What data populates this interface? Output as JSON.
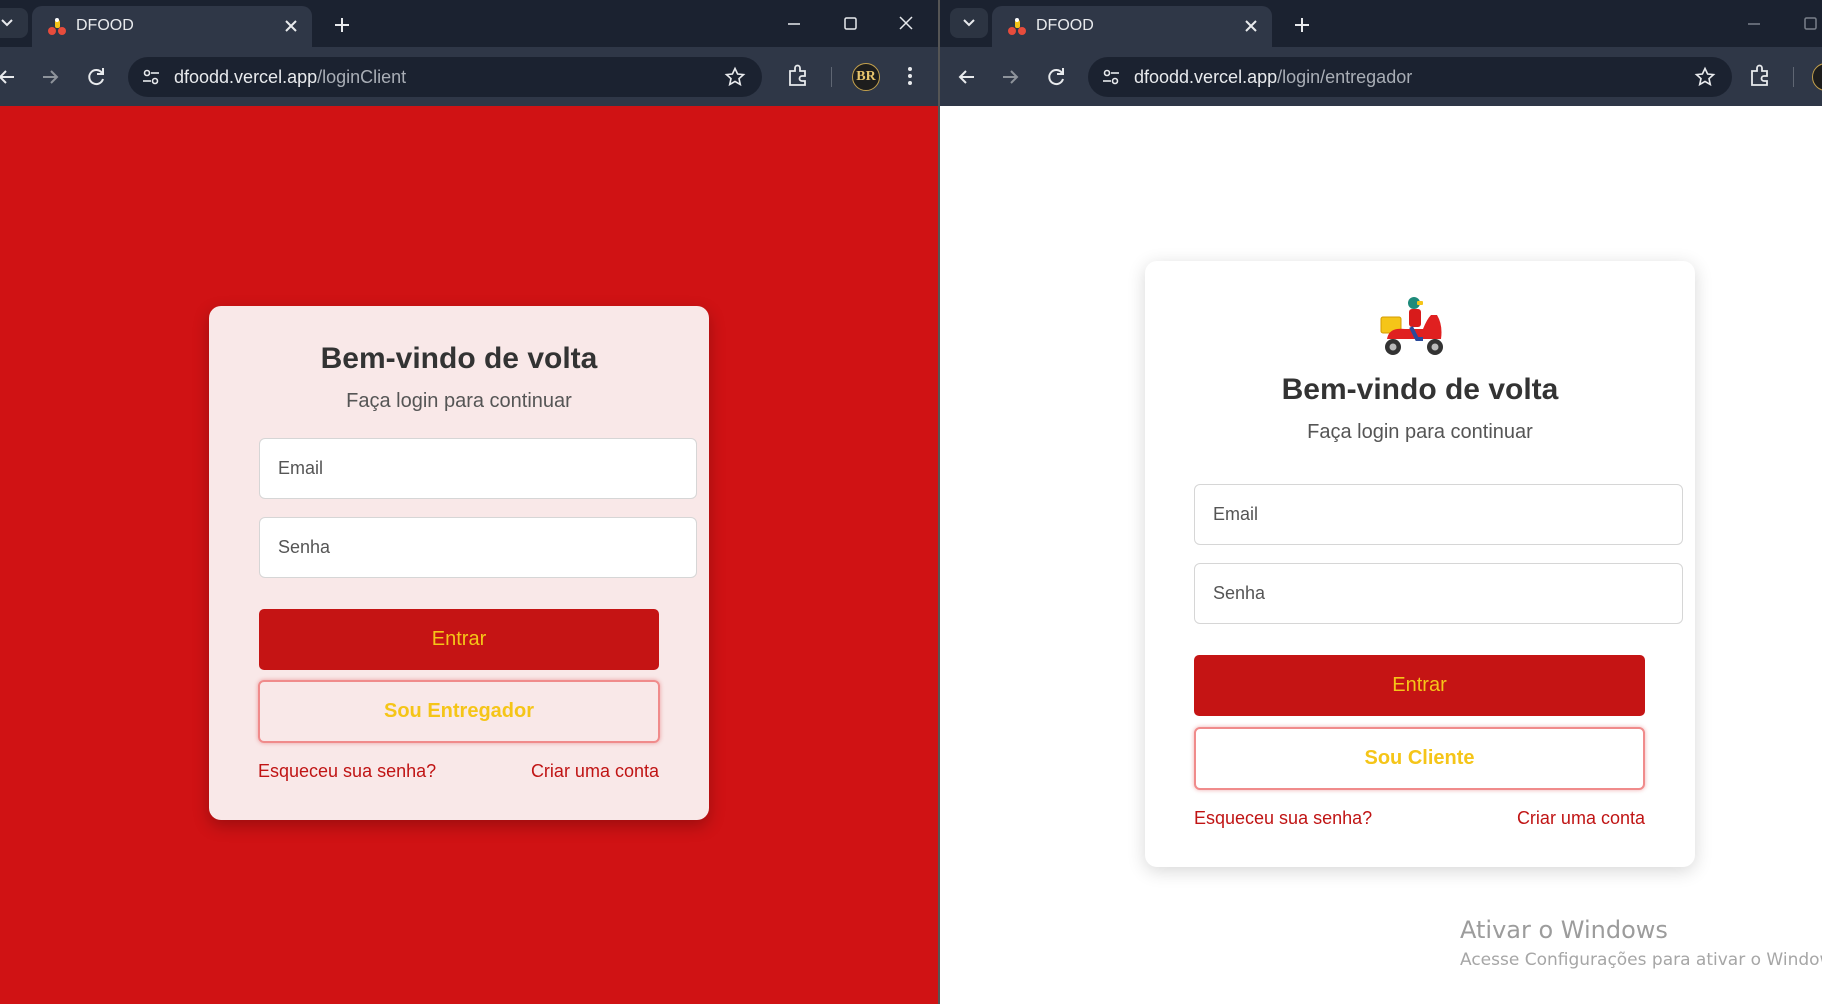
{
  "left_window": {
    "tab": {
      "title": "DFOOD"
    },
    "address": {
      "host": "dfoodd.vercel.app",
      "path": "/loginClient"
    },
    "profile": "BR",
    "page": {
      "title": "Bem-vindo de volta",
      "subtitle": "Faça login para continuar",
      "email_placeholder": "Email",
      "password_placeholder": "Senha",
      "submit_label": "Entrar",
      "switch_label": "Sou Entregador",
      "forgot_link": "Esqueceu sua senha?",
      "create_link": "Criar uma conta"
    }
  },
  "right_window": {
    "tab": {
      "title": "DFOOD"
    },
    "address": {
      "host": "dfoodd.vercel.app",
      "path": "/login/entregador"
    },
    "page": {
      "logo_icon": "delivery-scooter-icon",
      "title": "Bem-vindo de volta",
      "subtitle": "Faça login para continuar",
      "email_placeholder": "Email",
      "password_placeholder": "Senha",
      "submit_label": "Entrar",
      "switch_label": "Sou Cliente",
      "forgot_link": "Esqueceu sua senha?",
      "create_link": "Criar uma conta"
    }
  },
  "watermark": {
    "title": "Ativar o Windows",
    "subtitle": "Acesse Configurações para ativar o Windows."
  },
  "colors": {
    "brand_red": "#d01214",
    "button_red": "#c51414",
    "accent_yellow": "#f5c518",
    "card_pink": "#f9e8e8",
    "link_red": "#c01414"
  }
}
